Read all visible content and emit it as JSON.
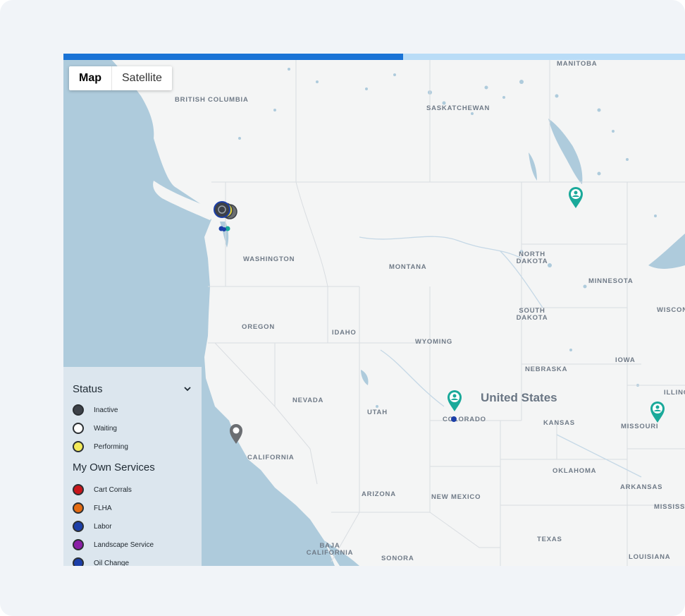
{
  "map_type": {
    "map_label": "Map",
    "satellite_label": "Satellite",
    "selected": "Map"
  },
  "loading_progress": 0.546,
  "country_label": "United States",
  "region_labels": [
    "BRITISH COLUMBIA",
    "SASKATCHEWAN",
    "MANITOBA",
    "WASHINGTON",
    "MONTANA",
    "NORTH DAKOTA",
    "MINNESOTA",
    "WISCON",
    "OREGON",
    "IDAHO",
    "WYOMING",
    "SOUTH DAKOTA",
    "NEBRASKA",
    "IOWA",
    "NEVADA",
    "UTAH",
    "COLORADO",
    "KANSAS",
    "MISSOURI",
    "ILLING",
    "CALIFORNIA",
    "OKLAHOMA",
    "ARKANSAS",
    "ARIZONA",
    "NEW MEXICO",
    "MISSISS",
    "TEXAS",
    "LOUISIANA",
    "BAJA CALIFORNIA",
    "SONORA"
  ],
  "legend": {
    "status_title": "Status",
    "status_items": [
      {
        "label": "Inactive",
        "color": "#3d4148"
      },
      {
        "label": "Waiting",
        "color": "#ffffff"
      },
      {
        "label": "Performing",
        "color": "#f3ea5a"
      }
    ],
    "services_title": "My Own Services",
    "service_items": [
      {
        "label": "Cart Corrals",
        "color": "#c8161b"
      },
      {
        "label": "FLHA",
        "color": "#e36b12"
      },
      {
        "label": "Labor",
        "color": "#1c3fa8"
      },
      {
        "label": "Landscape Service",
        "color": "#8a1fa6"
      },
      {
        "label": "Oil Change",
        "color": "#1c3fa8"
      }
    ]
  },
  "colors": {
    "water": "#aecbdc",
    "land": "#f4f5f5",
    "teal_marker": "#1aa99a",
    "gray_marker": "#6b6e72",
    "progress_fill": "#1a73d6",
    "progress_track": "#b9dcf7"
  },
  "markers": [
    {
      "type": "teal-pin-icon",
      "near": "MANITOBA"
    },
    {
      "type": "teal-pin-icon",
      "near": "COLORADO"
    },
    {
      "type": "teal-pin-icon",
      "near": "MISSOURI"
    },
    {
      "type": "gray-pin-icon",
      "near": "CALIFORNIA"
    },
    {
      "type": "cluster-icon",
      "near": "WASHINGTON"
    },
    {
      "type": "service-dot-icon",
      "near": "COLORADO"
    }
  ]
}
